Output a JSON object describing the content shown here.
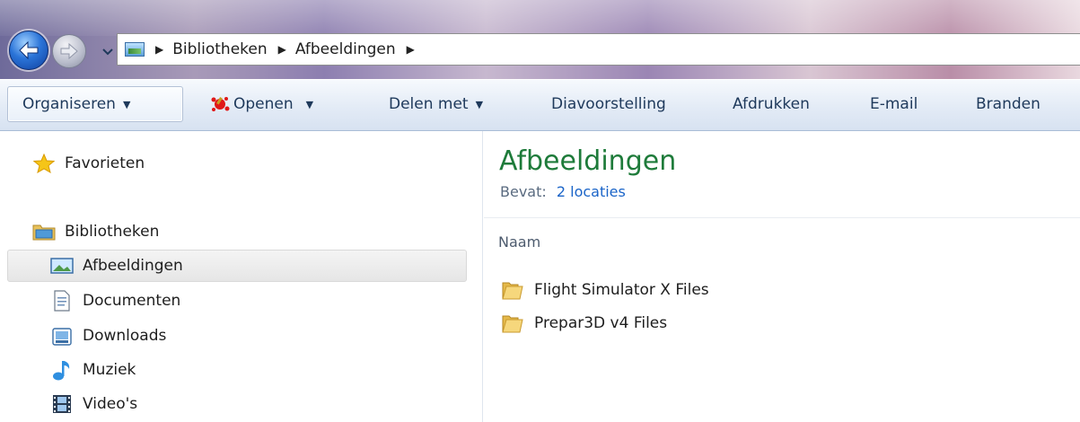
{
  "window": {
    "breadcrumb": [
      "Bibliotheken",
      "Afbeeldingen"
    ]
  },
  "toolbar": {
    "organize_label": "Organiseren",
    "open_label": "Openen",
    "share_label": "Delen met",
    "slideshow_label": "Diavoorstelling",
    "print_label": "Afdrukken",
    "email_label": "E-mail",
    "burn_label": "Branden"
  },
  "sidebar": {
    "favorites_label": "Favorieten",
    "libraries_label": "Bibliotheken",
    "items": [
      {
        "label": "Afbeeldingen",
        "icon": "pictures-library-icon",
        "selected": true
      },
      {
        "label": "Documenten",
        "icon": "documents-library-icon"
      },
      {
        "label": "Downloads",
        "icon": "downloads-icon"
      },
      {
        "label": "Muziek",
        "icon": "music-note-icon"
      },
      {
        "label": "Video's",
        "icon": "film-strip-icon"
      }
    ]
  },
  "main": {
    "title": "Afbeeldingen",
    "contains_label": "Bevat:",
    "contains_link": "2 locaties",
    "column_header": "Naam",
    "files": [
      {
        "name": "Flight Simulator X Files",
        "icon": "folder-icon"
      },
      {
        "name": "Prepar3D v4 Files",
        "icon": "folder-icon"
      }
    ]
  },
  "colors": {
    "title_green": "#1e7b3a",
    "link_blue": "#1a64c8",
    "toolbar_text": "#1e395b"
  }
}
